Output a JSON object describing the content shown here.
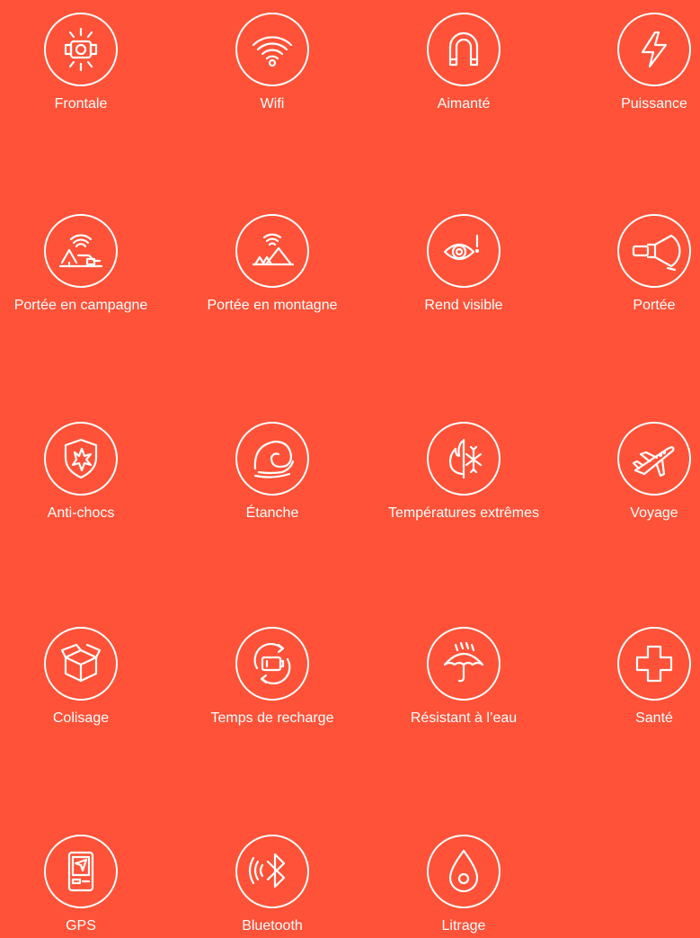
{
  "colors": {
    "background": "#ff5238",
    "foreground": "#ffffff"
  },
  "features": [
    {
      "label": "Frontale",
      "icon": "headlamp-icon"
    },
    {
      "label": "Wifi",
      "icon": "wifi-icon"
    },
    {
      "label": "Aimanté",
      "icon": "magnet-icon"
    },
    {
      "label": "Puissance",
      "icon": "lightning-icon"
    },
    {
      "label": "Portée en campagne",
      "icon": "countryside-range-icon"
    },
    {
      "label": "Portée en montagne",
      "icon": "mountain-range-icon"
    },
    {
      "label": "Rend visible",
      "icon": "eye-visibility-icon"
    },
    {
      "label": "Portée",
      "icon": "flashlight-beam-icon"
    },
    {
      "label": "Anti-chocs",
      "icon": "shockproof-shield-icon"
    },
    {
      "label": "Étanche",
      "icon": "wave-icon"
    },
    {
      "label": "Températures extrêmes",
      "icon": "fire-snow-icon"
    },
    {
      "label": "Voyage",
      "icon": "airplane-icon"
    },
    {
      "label": "Colisage",
      "icon": "box-icon"
    },
    {
      "label": "Temps de recharge",
      "icon": "recharge-battery-icon"
    },
    {
      "label": "Résistant à l’eau",
      "icon": "umbrella-rain-icon"
    },
    {
      "label": "Santé",
      "icon": "health-cross-icon"
    },
    {
      "label": "GPS",
      "icon": "gps-device-icon"
    },
    {
      "label": "Bluetooth",
      "icon": "bluetooth-icon"
    },
    {
      "label": "Litrage",
      "icon": "water-drop-icon"
    }
  ]
}
